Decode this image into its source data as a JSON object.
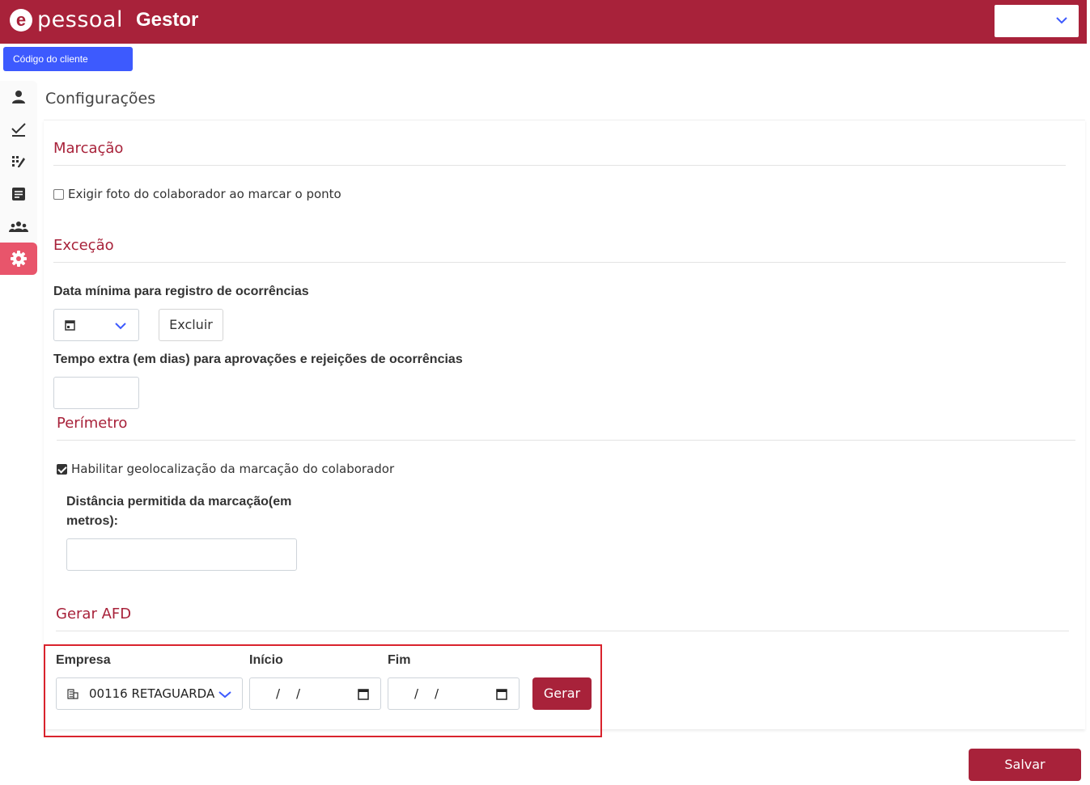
{
  "header": {
    "logo_letter": "e",
    "logo_text": "pessoal",
    "app_name": "Gestor",
    "brand_color": "#a8223a",
    "select_value": ""
  },
  "client_button": {
    "label": "Código do cliente",
    "color": "#3d5afe"
  },
  "sidebar": {
    "items": [
      {
        "icon": "person-icon",
        "active": false
      },
      {
        "icon": "check-icon",
        "active": false
      },
      {
        "icon": "grid-edit-icon",
        "active": false
      },
      {
        "icon": "document-icon",
        "active": false
      },
      {
        "icon": "group-icon",
        "active": false
      },
      {
        "icon": "gear-icon",
        "active": true
      }
    ]
  },
  "page": {
    "title": "Configurações"
  },
  "marcacao": {
    "title": "Marcação",
    "require_photo_label": "Exigir foto do colaborador ao marcar o ponto",
    "require_photo_checked": false
  },
  "excecao": {
    "title": "Exceção",
    "min_date_label": "Data mínima para registro de ocorrências",
    "min_date_value": "",
    "delete_button": "Excluir",
    "extra_time_label": "Tempo extra (em dias) para aprovações e rejeições de ocorrências",
    "extra_time_value": ""
  },
  "perimetro": {
    "title": "Perímetro",
    "geolocation_label": "Habilitar geolocalização da marcação do colaborador",
    "geolocation_checked": true,
    "distance_label_line1": "Distância permitida da marcação(em",
    "distance_label_line2": "metros):",
    "distance_value": ""
  },
  "afd": {
    "title": "Gerar AFD",
    "company_label": "Empresa",
    "company_value": "00116 RETAGUARDA",
    "start_label": "Início",
    "end_label": "Fim",
    "date_placeholder_sep": "/",
    "generate_button": "Gerar"
  },
  "footer": {
    "save_button": "Salvar"
  }
}
